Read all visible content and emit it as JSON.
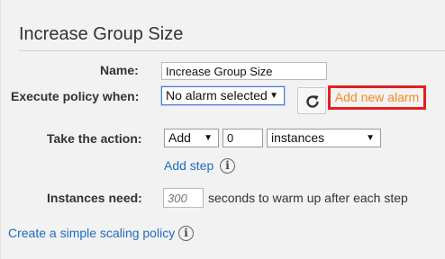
{
  "section": {
    "title": "Increase Group Size"
  },
  "name_row": {
    "label": "Name:",
    "value": "Increase Group Size"
  },
  "execute_row": {
    "label": "Execute policy when:",
    "alarm_select": "No alarm selected",
    "add_alarm_link": "Add new alarm",
    "refresh_icon": "refresh-icon"
  },
  "action_row": {
    "label": "Take the action:",
    "action_select": "Add",
    "amount_value": "0",
    "unit_select": "instances",
    "add_step_link": "Add step",
    "info_icon": "info-icon"
  },
  "instances_row": {
    "label": "Instances need:",
    "warmup_placeholder": "300",
    "suffix": "seconds to warm up after each step"
  },
  "footer": {
    "simple_policy_link": "Create a simple scaling policy",
    "info_icon": "info-icon"
  },
  "colors": {
    "link": "#1f6bbd",
    "highlight_border": "#e51e1e",
    "alarm_link": "#f58a1f"
  }
}
